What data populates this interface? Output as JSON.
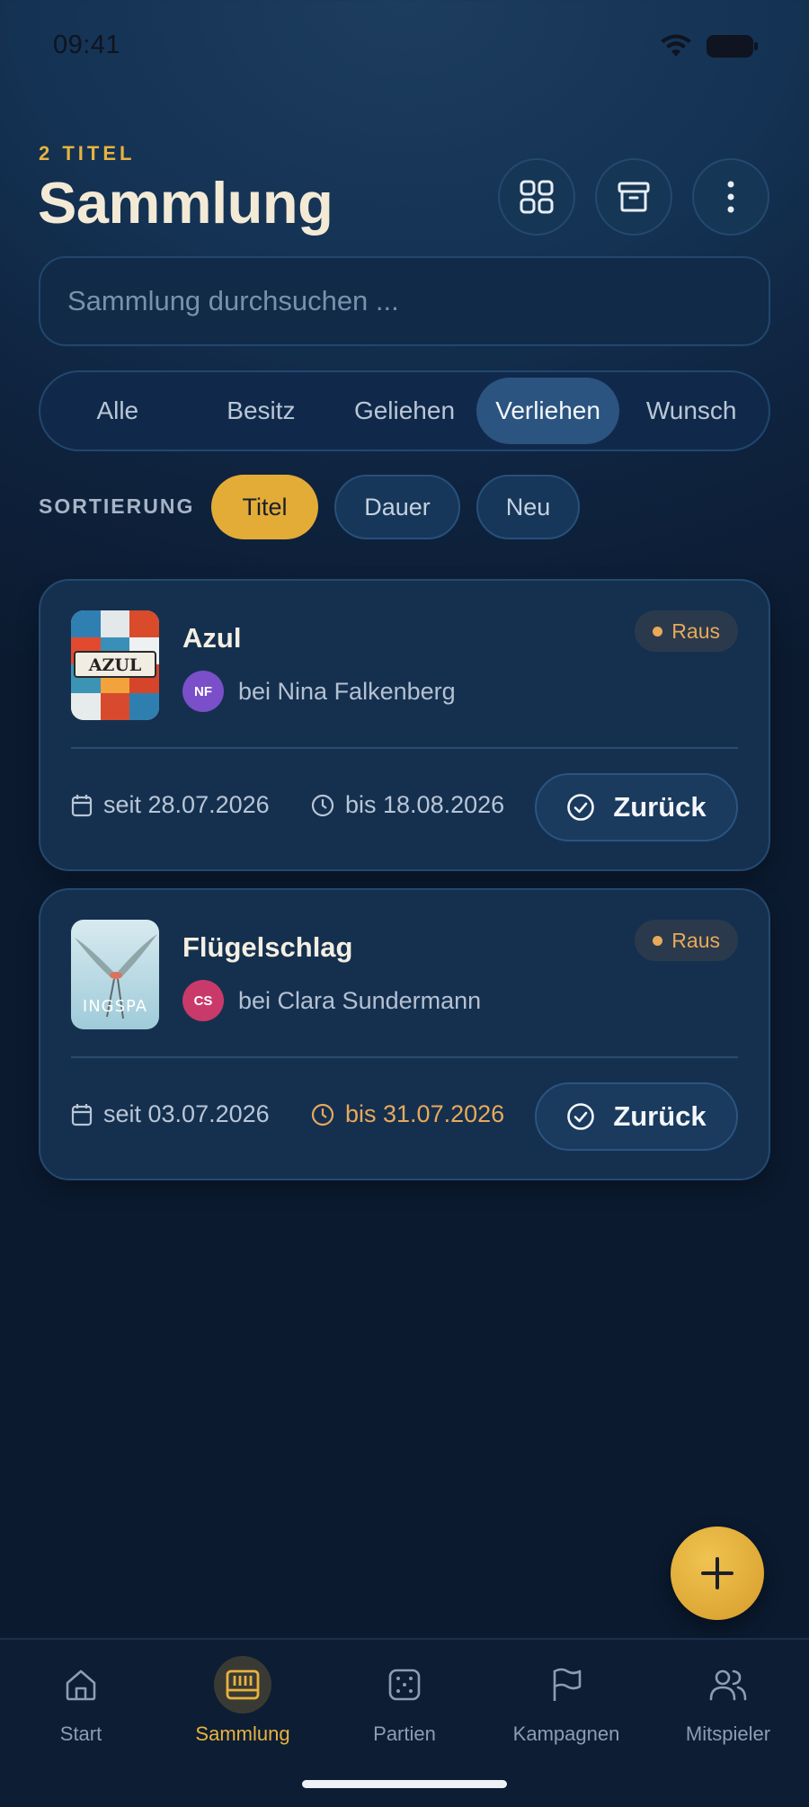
{
  "status": {
    "time": "09:41"
  },
  "header": {
    "count_label": "2 TITEL",
    "title": "Sammlung"
  },
  "search": {
    "placeholder": "Sammlung durchsuchen ..."
  },
  "tabs": [
    {
      "label": "Alle"
    },
    {
      "label": "Besitz"
    },
    {
      "label": "Geliehen"
    },
    {
      "label": "Verliehen",
      "active": true
    },
    {
      "label": "Wunsch"
    }
  ],
  "sort": {
    "label": "SORTIERUNG",
    "options": [
      {
        "label": "Titel",
        "active": true
      },
      {
        "label": "Dauer"
      },
      {
        "label": "Neu"
      }
    ]
  },
  "loans": [
    {
      "title": "Azul",
      "cover_text": "AZUL",
      "avatar_initials": "NF",
      "avatar_color": "#7a4fc9",
      "lender": "bei Nina Falkenberg",
      "badge": "Raus",
      "since": "seit 28.07.2026",
      "until": "bis 18.08.2026",
      "overdue": false,
      "action": "Zurück"
    },
    {
      "title": "Flügelschlag",
      "cover_text": "INGSPA",
      "avatar_initials": "CS",
      "avatar_color": "#c93a6b",
      "lender": "bei Clara Sundermann",
      "badge": "Raus",
      "since": "seit 03.07.2026",
      "until": "bis 31.07.2026",
      "overdue": true,
      "action": "Zurück"
    }
  ],
  "nav": [
    {
      "label": "Start",
      "icon": "home-icon"
    },
    {
      "label": "Sammlung",
      "icon": "shelf-icon",
      "active": true
    },
    {
      "label": "Partien",
      "icon": "dice-icon"
    },
    {
      "label": "Kampagnen",
      "icon": "flag-icon"
    },
    {
      "label": "Mitspieler",
      "icon": "users-icon"
    }
  ],
  "colors": {
    "accent": "#e3ac37",
    "warning": "#e9a95a",
    "background": "#0f2440"
  }
}
